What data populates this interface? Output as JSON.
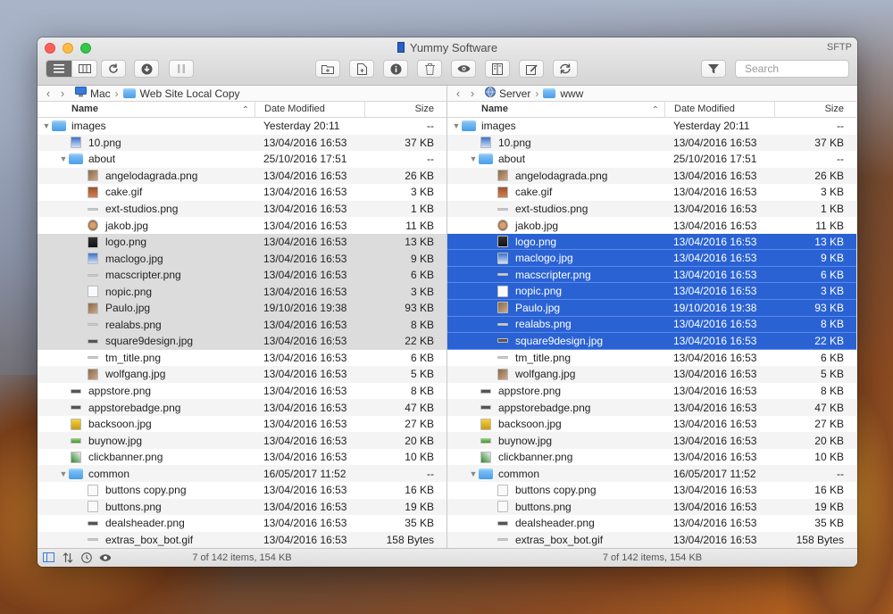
{
  "app": {
    "title": "Yummy Software",
    "protocol": "SFTP"
  },
  "toolbar": {
    "search_placeholder": "Search"
  },
  "left": {
    "path": [
      "Mac",
      "Web Site Local Copy"
    ],
    "columns": {
      "name": "Name",
      "date": "Date Modified",
      "size": "Size"
    },
    "status": "7 of 142 items, 154 KB"
  },
  "right": {
    "path": [
      "Server",
      "www"
    ],
    "columns": {
      "name": "Name",
      "date": "Date Modified",
      "size": "Size"
    },
    "status": "7 of 142 items, 154 KB"
  },
  "files": [
    {
      "name": "images",
      "date": "Yesterday 20:11",
      "size": "--",
      "level": 0,
      "type": "folder",
      "open": true,
      "icon": "folder-icon"
    },
    {
      "name": "10.png",
      "date": "13/04/2016 16:53",
      "size": "37 KB",
      "level": 1,
      "type": "file",
      "icon": "ico-blue"
    },
    {
      "name": "about",
      "date": "25/10/2016 17:51",
      "size": "--",
      "level": 1,
      "type": "folder",
      "open": true,
      "icon": "folder-icon"
    },
    {
      "name": "angelodagrada.png",
      "date": "13/04/2016 16:53",
      "size": "26 KB",
      "level": 2,
      "type": "file",
      "icon": "ico-photo"
    },
    {
      "name": "cake.gif",
      "date": "13/04/2016 16:53",
      "size": "3 KB",
      "level": 2,
      "type": "file",
      "icon": "ico-brown"
    },
    {
      "name": "ext-studios.png",
      "date": "13/04/2016 16:53",
      "size": "1 KB",
      "level": 2,
      "type": "file",
      "icon": "ico-line"
    },
    {
      "name": "jakob.jpg",
      "date": "13/04/2016 16:53",
      "size": "11 KB",
      "level": 2,
      "type": "file",
      "icon": "ico-face"
    },
    {
      "name": "logo.png",
      "date": "13/04/2016 16:53",
      "size": "13 KB",
      "level": 2,
      "type": "file",
      "icon": "ico-dark",
      "selected": true
    },
    {
      "name": "maclogo.jpg",
      "date": "13/04/2016 16:53",
      "size": "9 KB",
      "level": 2,
      "type": "file",
      "icon": "ico-blue",
      "selected": true
    },
    {
      "name": "macscripter.png",
      "date": "13/04/2016 16:53",
      "size": "6 KB",
      "level": 2,
      "type": "file",
      "icon": "ico-line",
      "selected": true
    },
    {
      "name": "nopic.png",
      "date": "13/04/2016 16:53",
      "size": "3 KB",
      "level": 2,
      "type": "file",
      "icon": "ico-light",
      "selected": true
    },
    {
      "name": "Paulo.jpg",
      "date": "19/10/2016 19:38",
      "size": "93 KB",
      "level": 2,
      "type": "file",
      "icon": "ico-photo",
      "selected": true
    },
    {
      "name": "realabs.png",
      "date": "13/04/2016 16:53",
      "size": "8 KB",
      "level": 2,
      "type": "file",
      "icon": "ico-line",
      "selected": true
    },
    {
      "name": "square9design.jpg",
      "date": "13/04/2016 16:53",
      "size": "22 KB",
      "level": 2,
      "type": "file",
      "icon": "ico-bar",
      "selected": true
    },
    {
      "name": "tm_title.png",
      "date": "13/04/2016 16:53",
      "size": "6 KB",
      "level": 2,
      "type": "file",
      "icon": "ico-line"
    },
    {
      "name": "wolfgang.jpg",
      "date": "13/04/2016 16:53",
      "size": "5 KB",
      "level": 2,
      "type": "file",
      "icon": "ico-photo"
    },
    {
      "name": "appstore.png",
      "date": "13/04/2016 16:53",
      "size": "8 KB",
      "level": 1,
      "type": "file",
      "icon": "ico-bar"
    },
    {
      "name": "appstorebadge.png",
      "date": "13/04/2016 16:53",
      "size": "47 KB",
      "level": 1,
      "type": "file",
      "icon": "ico-bar"
    },
    {
      "name": "backsoon.jpg",
      "date": "13/04/2016 16:53",
      "size": "27 KB",
      "level": 1,
      "type": "file",
      "icon": "ico-yellow"
    },
    {
      "name": "buynow.jpg",
      "date": "13/04/2016 16:53",
      "size": "20 KB",
      "level": 1,
      "type": "file",
      "icon": "ico-green"
    },
    {
      "name": "clickbanner.png",
      "date": "13/04/2016 16:53",
      "size": "10 KB",
      "level": 1,
      "type": "file",
      "icon": "ico-leaf"
    },
    {
      "name": "common",
      "date": "16/05/2017 11:52",
      "size": "--",
      "level": 1,
      "type": "folder",
      "open": true,
      "icon": "folder-icon"
    },
    {
      "name": "buttons copy.png",
      "date": "13/04/2016 16:53",
      "size": "16 KB",
      "level": 2,
      "type": "file",
      "icon": "ico-light"
    },
    {
      "name": "buttons.png",
      "date": "13/04/2016 16:53",
      "size": "19 KB",
      "level": 2,
      "type": "file",
      "icon": "ico-light"
    },
    {
      "name": "dealsheader.png",
      "date": "13/04/2016 16:53",
      "size": "35 KB",
      "level": 2,
      "type": "file",
      "icon": "ico-bar"
    },
    {
      "name": "extras_box_bot.gif",
      "date": "13/04/2016 16:53",
      "size": "158 Bytes",
      "level": 2,
      "type": "file",
      "icon": "ico-line"
    }
  ]
}
